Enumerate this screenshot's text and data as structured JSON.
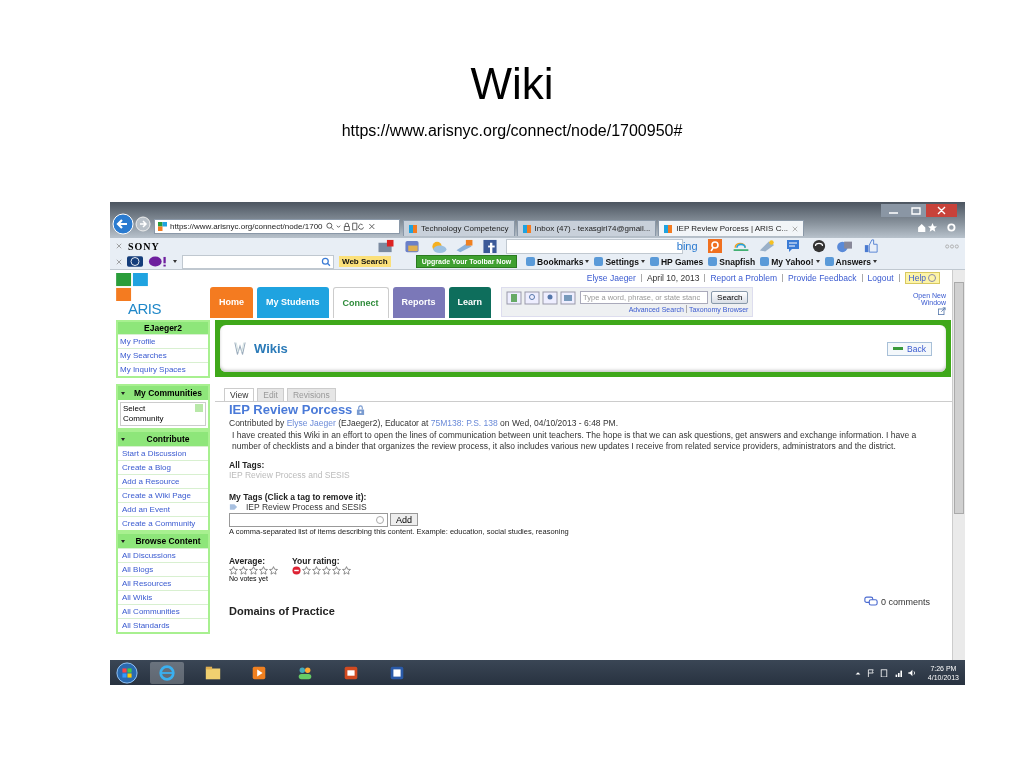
{
  "slide": {
    "title": "Wiki",
    "url": "https://www.arisnyc.org/connect/node/1700950#"
  },
  "browser": {
    "address": "https://www.arisnyc.org/connect/node/1700",
    "tabs": [
      {
        "label": "Technology Competency",
        "selected": false
      },
      {
        "label": "Inbox (47) - texasgirl74@gmail...",
        "selected": false
      },
      {
        "label": "IEP Review Porcess | ARIS C...",
        "selected": true
      }
    ],
    "brand": "SONY",
    "search_engine": "bing",
    "web_search": "Web Search",
    "upgrade": "Upgrade Your Toolbar Now",
    "links": [
      {
        "label": "Bookmarks",
        "dropdown": true
      },
      {
        "label": "Settings",
        "dropdown": true
      },
      {
        "label": "HP Games",
        "dropdown": false
      },
      {
        "label": "Snapfish",
        "dropdown": false
      },
      {
        "label": "My Yahoo!",
        "dropdown": true
      },
      {
        "label": "Answers",
        "dropdown": true
      }
    ]
  },
  "site": {
    "logo": "ARIS",
    "top_links": [
      {
        "label": "Elyse Jaeger",
        "kind": "link"
      },
      {
        "label": "April 10, 2013",
        "kind": "text"
      },
      {
        "label": "Report a Problem",
        "kind": "link"
      },
      {
        "label": "Provide Feedback",
        "kind": "link"
      },
      {
        "label": "Logout",
        "kind": "link"
      }
    ],
    "help": "Help",
    "nav": [
      {
        "label": "Home",
        "color": "#f47b20",
        "selected": false
      },
      {
        "label": "My Students",
        "color": "#1fa3e0",
        "selected": false
      },
      {
        "label": "Connect",
        "color": "#2e8b3a",
        "selected": true
      },
      {
        "label": "Reports",
        "color": "#7b78b8",
        "selected": false
      },
      {
        "label": "Learn",
        "color": "#0e6e5c",
        "selected": false
      }
    ],
    "search": {
      "placeholder": "Type a word, phrase, or state stanc",
      "button": "Search",
      "links": [
        "Advanced Search",
        "Taxonomy Browser"
      ]
    },
    "open_window": "Open New Window"
  },
  "sidebar": {
    "user": "EJaeger2",
    "user_links": [
      "My Profile",
      "My Searches",
      "My Inquiry Spaces"
    ],
    "sections": [
      {
        "title": "My Communities",
        "kind": "select",
        "value": "Select Community"
      },
      {
        "title": "Contribute",
        "kind": "links",
        "items": [
          "Start a Discussion",
          "Create a Blog",
          "Add a Resource",
          "Create a Wiki Page",
          "Add an Event",
          "Create a Community"
        ]
      },
      {
        "title": "Browse Content",
        "kind": "links",
        "items": [
          "All Discussions",
          "All Blogs",
          "All Resources",
          "All Wikis",
          "All Communities",
          "All Standards"
        ]
      }
    ]
  },
  "main": {
    "heading": "Wikis",
    "back": "Back",
    "tabs": [
      {
        "label": "View",
        "selected": true
      },
      {
        "label": "Edit",
        "selected": false
      },
      {
        "label": "Revisions",
        "selected": false
      }
    ],
    "title": "IEP Review Porcess",
    "byline": [
      {
        "text": "Contributed by ",
        "kind": "text"
      },
      {
        "text": "Elyse Jaeger",
        "kind": "link"
      },
      {
        "text": " (EJaeger2), Educator at ",
        "kind": "text"
      },
      {
        "text": "75M138: P.S. 138",
        "kind": "link"
      },
      {
        "text": " on Wed, 04/10/2013 - 6:48 PM.",
        "kind": "text"
      }
    ],
    "body": "I have created this Wiki in an effort to open the lines of communication between unit teachers.  The hope is that we can ask questions, get answers and exchange information.  I have a number of checklists and a binder that organizes the review process, it also includes various new updates I receive from related service providers, administrators and the district.",
    "all_tags_label": "All Tags:",
    "all_tags": "IEP Review Process and SESIS",
    "my_tags_label": "My Tags (Click a tag to remove it):",
    "my_tag": "IEP Review Process and SESIS",
    "add_button": "Add",
    "hint": "A comma-separated list of items describing this content. Example: education, social studies, reasoning",
    "average": {
      "label": "Average:",
      "stars": 0
    },
    "rating": {
      "label": "Your rating:",
      "stars": 0
    },
    "votes": "No votes yet",
    "comments": "0 comments",
    "next_heading": "Domains of Practice"
  },
  "taskbar": {
    "time": "7:26 PM",
    "date": "4/10/2013"
  }
}
